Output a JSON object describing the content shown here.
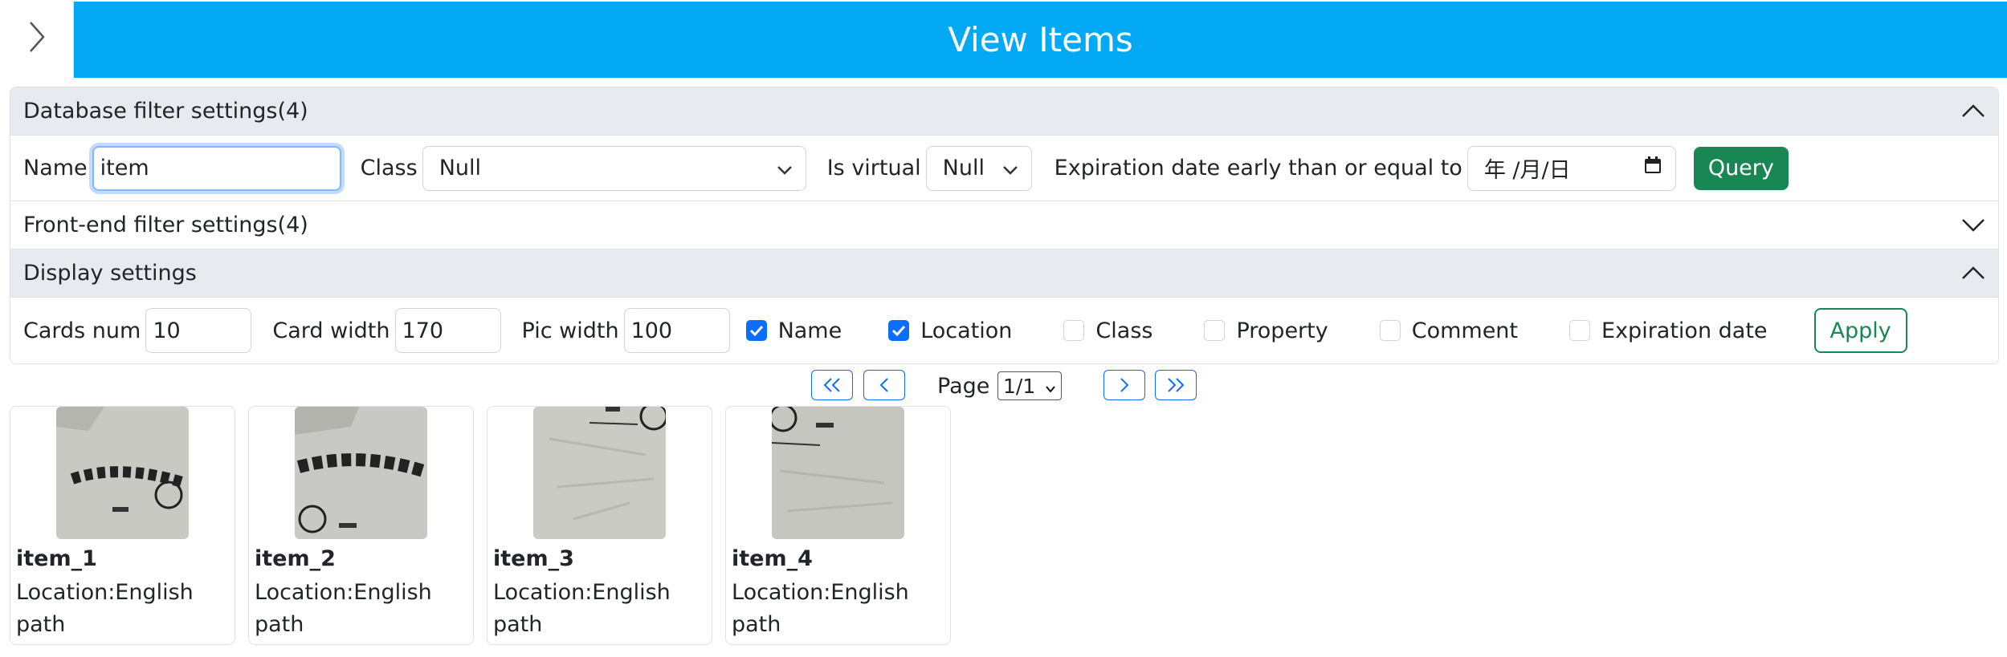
{
  "header": {
    "toggle_icon": "chevron-right-icon",
    "title": "View Items"
  },
  "db_filter": {
    "title": "Database filter settings(4)",
    "name_label": "Name",
    "name_value": "item",
    "class_label": "Class",
    "class_value": "Null",
    "virtual_label": "Is virtual",
    "virtual_value": "Null",
    "expiration_label": "Expiration date early than or equal to",
    "expiration_value": "年 /月/日",
    "query_label": "Query"
  },
  "frontend_filter": {
    "title": "Front-end filter settings(4)"
  },
  "display": {
    "title": "Display settings",
    "cards_num_label": "Cards num",
    "cards_num_value": "10",
    "card_width_label": "Card width",
    "card_width_value": "170",
    "pic_width_label": "Pic width",
    "pic_width_value": "100",
    "checks": [
      {
        "label": "Name",
        "checked": true
      },
      {
        "label": "Location",
        "checked": true
      },
      {
        "label": "Class",
        "checked": false
      },
      {
        "label": "Property",
        "checked": false
      },
      {
        "label": "Comment",
        "checked": false
      },
      {
        "label": "Expiration date",
        "checked": false
      }
    ],
    "apply_label": "Apply"
  },
  "pagination": {
    "page_label": "Page",
    "page_value": "1/1"
  },
  "cards": [
    {
      "name": "item_1",
      "location": "Location:English path"
    },
    {
      "name": "item_2",
      "location": "Location:English path"
    },
    {
      "name": "item_3",
      "location": "Location:English path"
    },
    {
      "name": "item_4",
      "location": "Location:English path"
    }
  ],
  "colors": {
    "banner": "#03a9f4",
    "primary": "#0d6efd",
    "success": "#198754"
  }
}
